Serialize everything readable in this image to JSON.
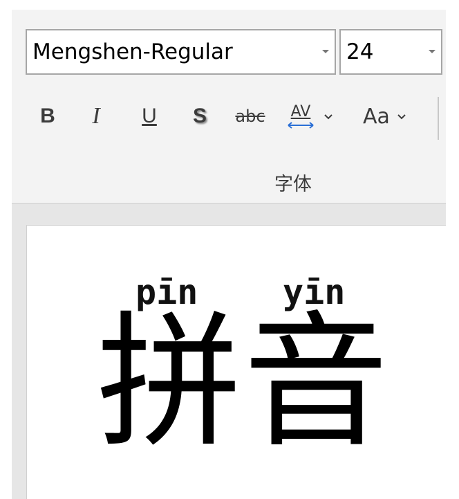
{
  "toolbar": {
    "font_name": "Mengshen-Regular",
    "font_size": "24",
    "bold_label": "B",
    "italic_label": "I",
    "underline_label": "U",
    "shadow_label": "S",
    "strikethrough_label": "abc",
    "spacing_label": "AV",
    "change_case_label": "Aa",
    "group_label": "字体"
  },
  "document": {
    "pinyin": [
      "pīn",
      "yīn"
    ],
    "characters": [
      "拼",
      "音"
    ]
  },
  "icons": [
    "dropdown-arrow-icon",
    "chevron-down-icon",
    "character-spacing-icon"
  ]
}
